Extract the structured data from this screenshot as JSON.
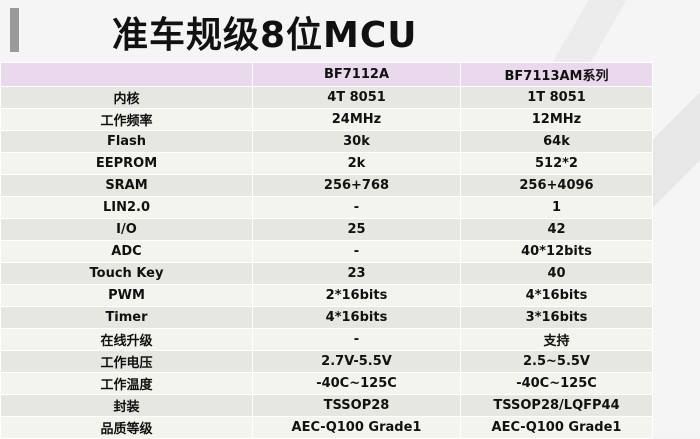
{
  "title": "准车规级8位MCU",
  "table": {
    "headers": [
      "",
      "BF7112A",
      "BF7113AM系列"
    ],
    "rows": [
      [
        "内核",
        "4T 8051",
        "1T 8051"
      ],
      [
        "工作频率",
        "24MHz",
        "12MHz"
      ],
      [
        "Flash",
        "30k",
        "64k"
      ],
      [
        "EEPROM",
        "2k",
        "512*2"
      ],
      [
        "SRAM",
        "256+768",
        "256+4096"
      ],
      [
        "LIN2.0",
        "-",
        "1"
      ],
      [
        "I/O",
        "25",
        "42"
      ],
      [
        "ADC",
        "-",
        "40*12bits"
      ],
      [
        "Touch Key",
        "23",
        "40"
      ],
      [
        "PWM",
        "2*16bits",
        "4*16bits"
      ],
      [
        "Timer",
        "4*16bits",
        "3*16bits"
      ],
      [
        "在线升级",
        "-",
        "支持"
      ],
      [
        "工作电压",
        "2.7V-5.5V",
        "2.5~5.5V"
      ],
      [
        "工作温度",
        "-40C~125C",
        "-40C~125C"
      ],
      [
        "封装",
        "TSSOP28",
        "TSSOP28/LQFP44"
      ],
      [
        "品质等级",
        "AEC-Q100 Grade1",
        "AEC-Q100 Grade1"
      ]
    ]
  }
}
